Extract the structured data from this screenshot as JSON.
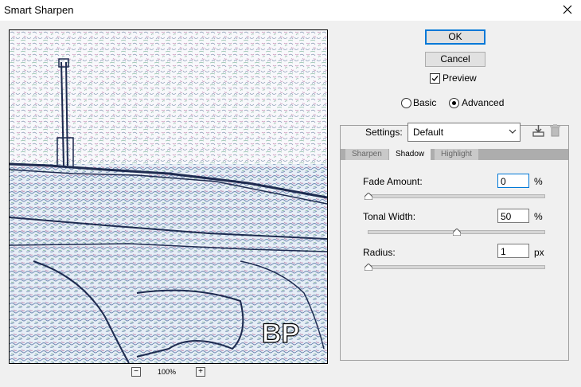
{
  "window": {
    "title": "Smart Sharpen"
  },
  "preview": {
    "zoom": "100%",
    "watermark": "BP"
  },
  "buttons": {
    "ok": "OK",
    "cancel": "Cancel"
  },
  "preview_toggle": {
    "label": "Preview",
    "checked": true
  },
  "mode": {
    "basic": "Basic",
    "advanced": "Advanced",
    "selected": "Advanced"
  },
  "settings": {
    "label": "Settings:",
    "value": "Default"
  },
  "tabs": [
    {
      "label": "Sharpen"
    },
    {
      "label": "Shadow",
      "active": true
    },
    {
      "label": "Highlight"
    }
  ],
  "shadow": {
    "fade_amount": {
      "label": "Fade Amount:",
      "value": "0",
      "unit": "%",
      "slider_fraction": 0
    },
    "tonal_width": {
      "label": "Tonal Width:",
      "value": "50",
      "unit": "%",
      "slider_fraction": 0.5
    },
    "radius": {
      "label": "Radius:",
      "value": "1",
      "unit": "px",
      "slider_fraction": 0
    }
  }
}
